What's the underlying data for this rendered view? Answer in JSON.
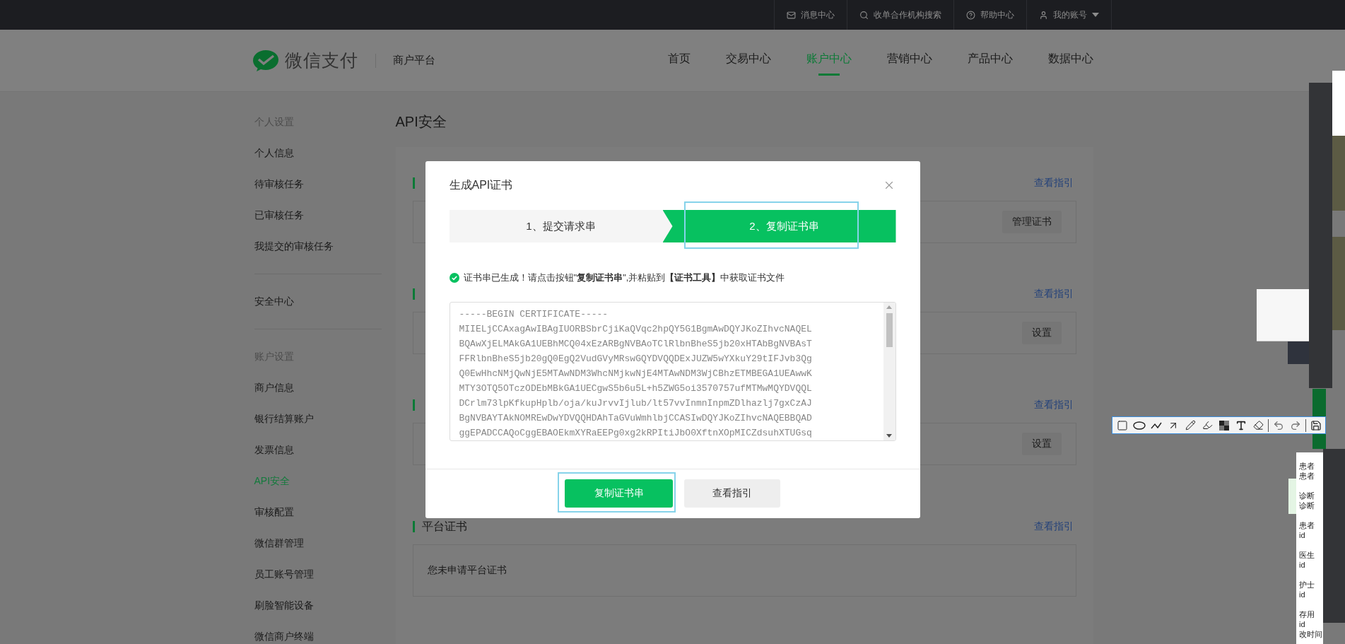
{
  "top_bar": {
    "items": [
      {
        "kind": "mail",
        "label": "消息中心",
        "dropdown": false
      },
      {
        "kind": "search",
        "label": "收单合作机构搜索",
        "dropdown": false
      },
      {
        "kind": "help",
        "label": "帮助中心",
        "dropdown": false
      },
      {
        "kind": "user",
        "label": "我的账号",
        "dropdown": true
      }
    ]
  },
  "header": {
    "brand": "微信支付",
    "platform": "商户平台",
    "nav": [
      {
        "label": "首页",
        "selected": false
      },
      {
        "label": "交易中心",
        "selected": false
      },
      {
        "label": "账户中心",
        "selected": true
      },
      {
        "label": "营销中心",
        "selected": false
      },
      {
        "label": "产品中心",
        "selected": false
      },
      {
        "label": "数据中心",
        "selected": false
      }
    ]
  },
  "sidebar": {
    "groups": [
      {
        "title": "个人设置",
        "items": [
          {
            "label": "个人信息",
            "selected": false
          },
          {
            "label": "待审核任务",
            "selected": false
          },
          {
            "label": "已审核任务",
            "selected": false
          },
          {
            "label": "我提交的审核任务",
            "selected": false
          }
        ]
      },
      {
        "items": [
          {
            "label": "安全中心",
            "selected": false
          }
        ]
      },
      {
        "title": "账户设置",
        "items": [
          {
            "label": "商户信息",
            "selected": false
          },
          {
            "label": "银行结算账户",
            "selected": false
          },
          {
            "label": "发票信息",
            "selected": false
          },
          {
            "label": "API安全",
            "selected": true
          },
          {
            "label": "审核配置",
            "selected": false
          },
          {
            "label": "微信群管理",
            "selected": false
          },
          {
            "label": "员工账号管理",
            "selected": false
          },
          {
            "label": "刷脸智能设备",
            "selected": false
          },
          {
            "label": "微信商户终端",
            "selected": false
          }
        ]
      }
    ]
  },
  "page": {
    "title": "API安全",
    "sections": [
      {
        "link": "查看指引",
        "action": "管理证书"
      },
      {
        "link": "查看指引",
        "action": "设置"
      },
      {
        "link": "查看指引",
        "action": "设置"
      },
      {
        "heading": "平台证书",
        "link": "查看指引",
        "note": "您未申请平台证书"
      }
    ]
  },
  "dialog": {
    "title": "生成API证书",
    "steps": [
      {
        "label": "1、提交请求串",
        "selected": false
      },
      {
        "label": "2、复制证书串",
        "selected": true
      }
    ],
    "message": "证书串已生成！请点击按钮\"**复制证书串**\",并粘贴到**【证书工具】**中获取证书文件",
    "certificate": [
      "-----BEGIN CERTIFICATE-----",
      "MIIELjCCAxagAwIBAgIUORBSbrCjiKaQVqc2hpQY5G1BgmAwDQYJKoZIhvcNAQEL",
      "BQAwXjELMAkGA1UEBhMCQ04xEzARBgNVBAoTClRlbnBheS5jb20xHTAbBgNVBAsT",
      "FFRlbnBheS5jb20gQ0EgQ2VudGVyMRswGQYDVQQDExJUZW5wYXkuY29tIFJvb3Qg",
      "Q0EwHhcNMjQwNjE5MTAwNDM3WhcNMjkwNjE4MTAwNDM3WjCBhzETMBEGA1UEAwwK",
      "MTY3OTQ5OTczODEbMBkGA1UECgwS5b6u5L+h5ZWG5oi3570757ufMTMwMQYDVQQL",
      "DCrlm73lpKfkupHplb/oja/kuJrvvIjlub/lt57vvInmnInpmZDlhazlj7gxCzAJ",
      "BgNVBAYTAkNOMREwDwYDVQQHDAhTaGVuWmhlbjCCASIwDQYJKoZIhvcNAQEBBQAD",
      "ggEPADCCAQoCggEBAOEkmXYRaEEPg0xg2kRPItiJbO0XftnXOpMICZdsuhXTUGsq"
    ],
    "buttons": [
      {
        "label": "复制证书串",
        "kind": "primary"
      },
      {
        "label": "查看指引",
        "kind": "secondary"
      }
    ]
  },
  "side_panel": {
    "lines": [
      "患者",
      "患者",
      "诊断",
      "诊断",
      "患者",
      "id",
      "医生",
      "id",
      "护士",
      "id",
      "存用",
      "id",
      "改时间"
    ]
  }
}
